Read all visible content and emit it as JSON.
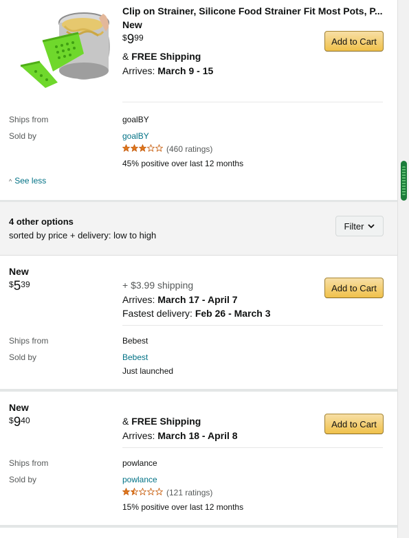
{
  "main_offer": {
    "title": "Clip on Strainer, Silicone Food Strainer Fit Most Pots, P...",
    "condition": "New",
    "price": {
      "symbol": "$",
      "whole": "9",
      "fraction": "99"
    },
    "shipping_prefix": "& ",
    "shipping": "FREE Shipping",
    "arrives_label": "Arrives: ",
    "arrives": "March 9 - 15",
    "add_to_cart": "Add to Cart",
    "ships_from_label": "Ships from",
    "ships_from": "goalBY",
    "sold_by_label": "Sold by",
    "sold_by": "goalBY",
    "rating_stars": 3,
    "ratings": "(460 ratings)",
    "positive": "45% positive over last 12 months",
    "see_less": "See less"
  },
  "options_header": {
    "count": "4 other options",
    "sorted": "sorted by price + delivery: low to high",
    "filter": "Filter"
  },
  "offers": [
    {
      "condition": "New",
      "price": {
        "symbol": "$",
        "whole": "5",
        "fraction": "39"
      },
      "shipping": "+ $3.99 shipping",
      "arrives_label": "Arrives: ",
      "arrives": "March 17 - April 7",
      "fastest_label": "Fastest delivery: ",
      "fastest": "Feb 26 - March 3",
      "add_to_cart": "Add to Cart",
      "ships_from_label": "Ships from",
      "ships_from": "Bebest",
      "sold_by_label": "Sold by",
      "sold_by": "Bebest",
      "note": "Just launched"
    },
    {
      "condition": "New",
      "price": {
        "symbol": "$",
        "whole": "9",
        "fraction": "40"
      },
      "shipping_prefix": "& ",
      "shipping": "FREE Shipping",
      "arrives_label": "Arrives: ",
      "arrives": "March 18 - April 8",
      "add_to_cart": "Add to Cart",
      "ships_from_label": "Ships from",
      "ships_from": "powlance",
      "sold_by_label": "Sold by",
      "sold_by": "powlance",
      "rating_stars": 1.5,
      "ratings": "(121 ratings)",
      "positive": "15% positive over last 12 months"
    }
  ],
  "colors": {
    "link": "#007185",
    "star": "#de7921",
    "button": "#f0c14b"
  }
}
